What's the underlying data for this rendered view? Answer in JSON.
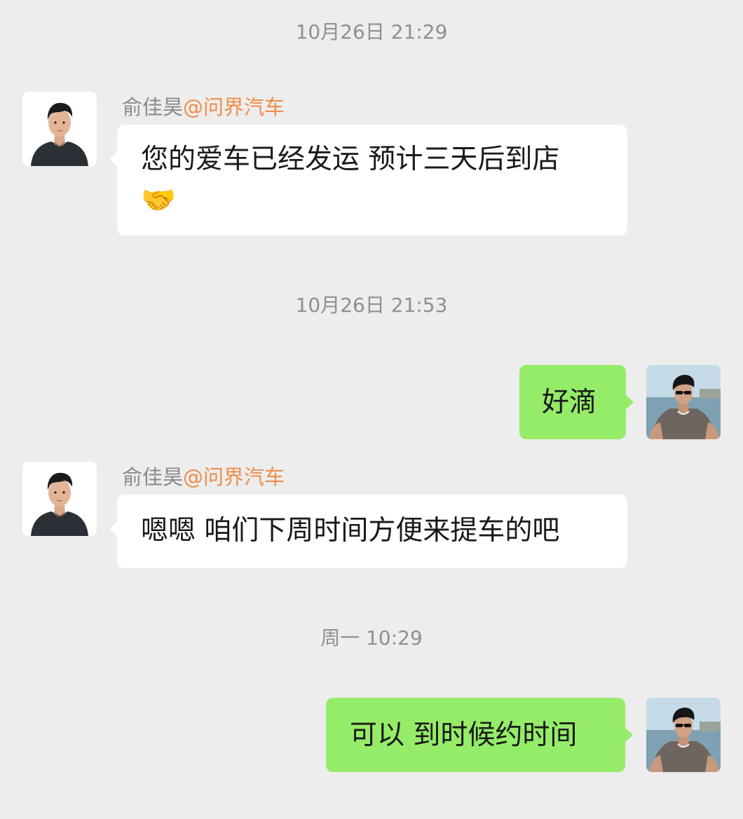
{
  "chat": {
    "timestamps": [
      "10月26日 21:29",
      "10月26日 21:53",
      "周一 10:29"
    ],
    "contact": {
      "name": "俞佳昊",
      "org": "@问界汽车"
    },
    "messages": [
      {
        "from": "contact",
        "text": "您的爱车已经发运 预计三天后到店",
        "emoji": "🤝"
      },
      {
        "from": "me",
        "text": "好滴"
      },
      {
        "from": "contact",
        "text": "嗯嗯 咱们下周时间方便来提车的吧"
      },
      {
        "from": "me",
        "text": "可以 到时候约时间"
      }
    ],
    "icons": {
      "contact_avatar": "person-portrait-dark-shirt",
      "my_avatar": "person-beach-sunglasses"
    },
    "colors": {
      "background": "#ededed",
      "incoming_bubble": "#ffffff",
      "outgoing_bubble": "#95ec69",
      "org_accent": "#ef8d4a",
      "timestamp": "#8f8f8f"
    }
  }
}
